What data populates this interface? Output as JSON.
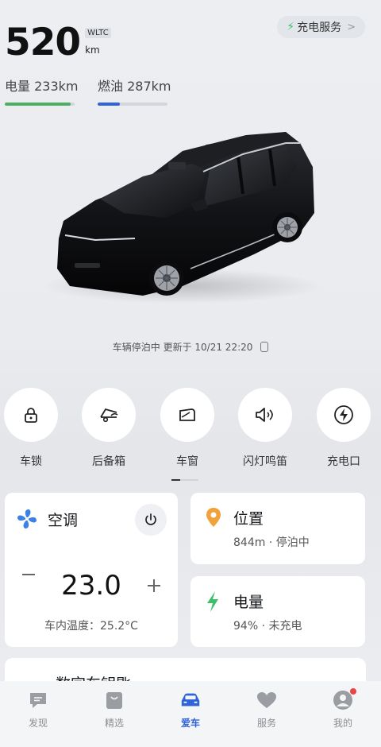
{
  "header": {
    "range_value": "520",
    "range_standard": "WLTC",
    "range_unit": "km",
    "charge_service_label": "充电服务",
    "electric_label": "电量 233km",
    "fuel_label": "燃油 287km",
    "electric_level": 0.94,
    "fuel_level": 0.32,
    "electric_color": "#4caf62",
    "fuel_color": "#3064d8"
  },
  "status": {
    "text": "车辆停泊中 更新于 10/21 22:20"
  },
  "controls": [
    {
      "label": "车锁",
      "icon": "lock-icon"
    },
    {
      "label": "后备箱",
      "icon": "trunk-icon"
    },
    {
      "label": "车窗",
      "icon": "window-icon"
    },
    {
      "label": "闪灯鸣笛",
      "icon": "horn-icon"
    },
    {
      "label": "充电口",
      "icon": "charge-port-icon"
    }
  ],
  "ac": {
    "title": "空调",
    "temperature": "23.0",
    "inside_temp": "车内温度：25.2°C"
  },
  "location": {
    "title": "位置",
    "detail": "844m · 停泊中"
  },
  "battery": {
    "title": "电量",
    "detail": "94% · 未充电"
  },
  "digital_key": {
    "title": "数字车钥匙"
  },
  "tabs": [
    {
      "label": "发现",
      "icon": "discover-icon"
    },
    {
      "label": "精选",
      "icon": "shop-bag-icon"
    },
    {
      "label": "爱车",
      "icon": "car-icon",
      "active": true
    },
    {
      "label": "服务",
      "icon": "heart-icon"
    },
    {
      "label": "我的",
      "icon": "profile-icon"
    }
  ],
  "colors": {
    "accent": "#2f63d9",
    "green": "#3fbf6c",
    "orange": "#f0a23b",
    "fan_blue": "#3b82e6"
  }
}
